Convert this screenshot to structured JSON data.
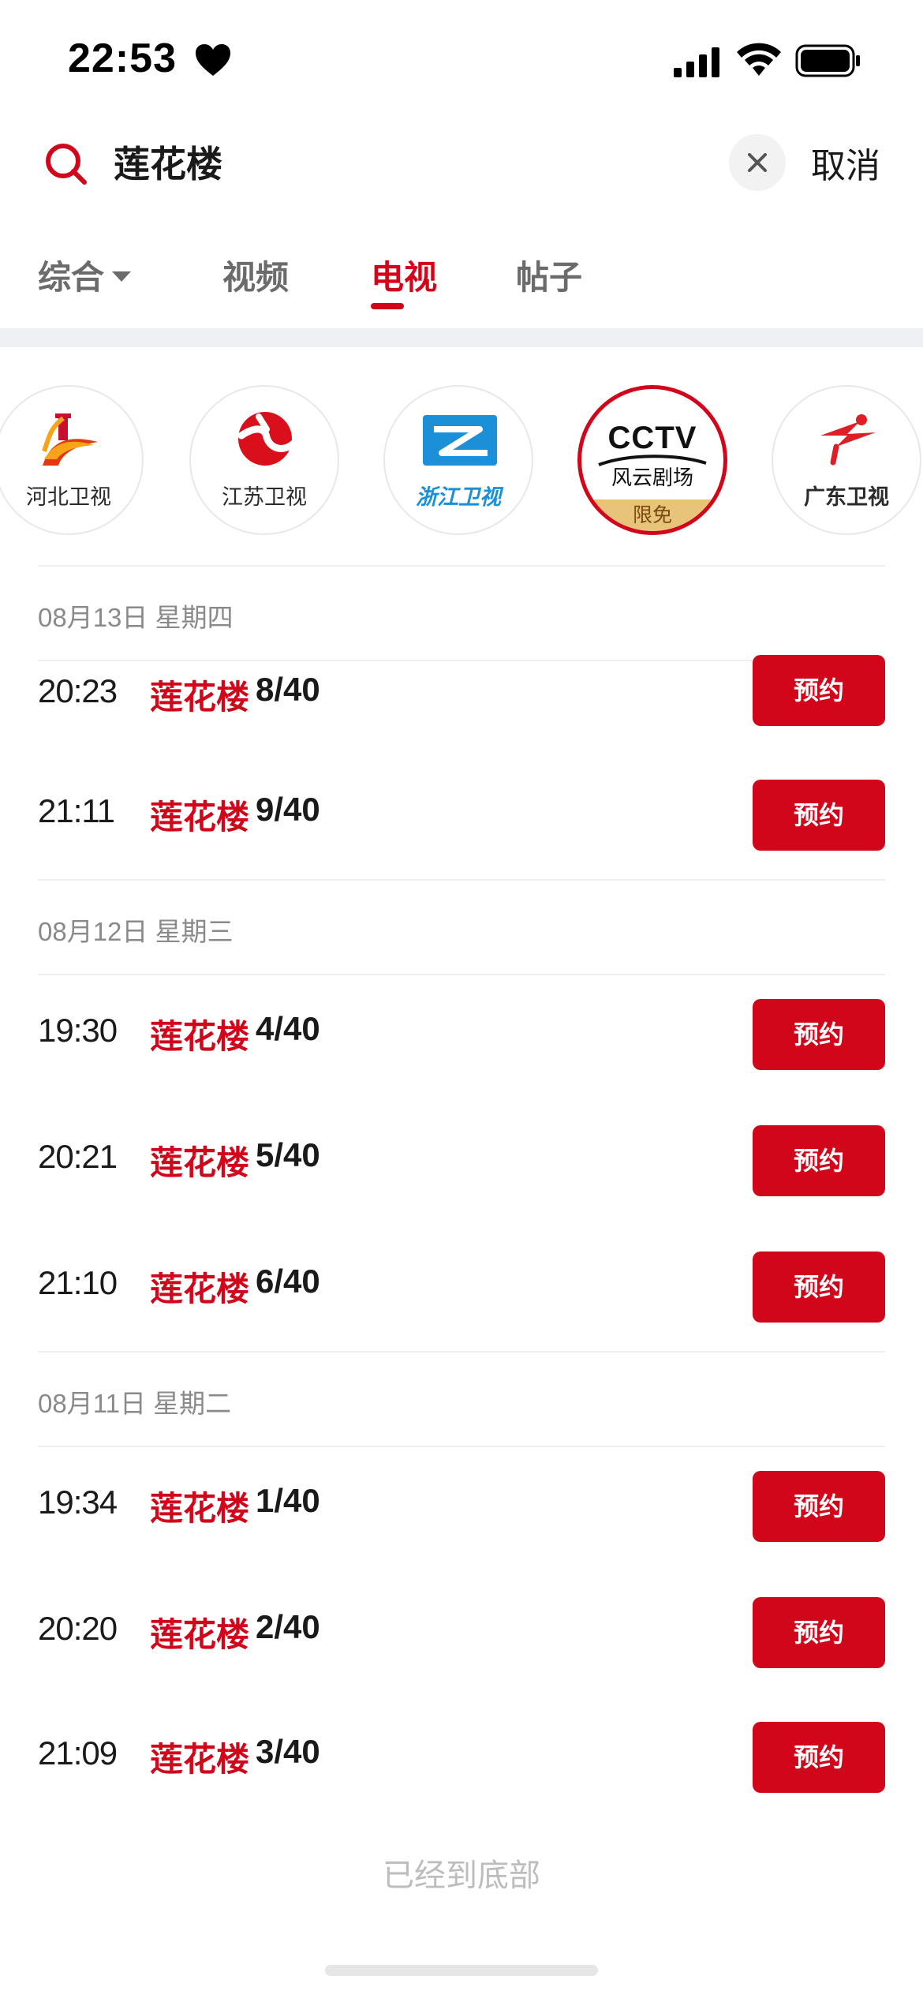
{
  "status_bar": {
    "time": "22:53"
  },
  "search": {
    "query": "莲花楼",
    "cancel_label": "取消"
  },
  "tabs": [
    {
      "label": "综合",
      "has_dropdown": true
    },
    {
      "label": "视频"
    },
    {
      "label": "电视",
      "active": true
    },
    {
      "label": "帖子"
    }
  ],
  "channels": [
    {
      "name": "河北卫视"
    },
    {
      "name": "江苏卫视"
    },
    {
      "name": "浙江卫视"
    },
    {
      "name": "CCTV",
      "subname": "风云剧场",
      "badge": "限免",
      "selected": true
    },
    {
      "name": "广东卫视"
    }
  ],
  "schedule": [
    {
      "date": "08月13日 星期四",
      "items": [
        {
          "time": "20:23",
          "title": "莲花楼",
          "episode": "8/40",
          "button": "预约"
        },
        {
          "time": "21:11",
          "title": "莲花楼",
          "episode": "9/40",
          "button": "预约"
        }
      ]
    },
    {
      "date": "08月12日 星期三",
      "items": [
        {
          "time": "19:30",
          "title": "莲花楼",
          "episode": "4/40",
          "button": "预约"
        },
        {
          "time": "20:21",
          "title": "莲花楼",
          "episode": "5/40",
          "button": "预约"
        },
        {
          "time": "21:10",
          "title": "莲花楼",
          "episode": "6/40",
          "button": "预约"
        }
      ]
    },
    {
      "date": "08月11日 星期二",
      "items": [
        {
          "time": "19:34",
          "title": "莲花楼",
          "episode": "1/40",
          "button": "预约"
        },
        {
          "time": "20:20",
          "title": "莲花楼",
          "episode": "2/40",
          "button": "预约"
        },
        {
          "time": "21:09",
          "title": "莲花楼",
          "episode": "3/40",
          "button": "预约"
        }
      ]
    }
  ],
  "end_text": "已经到底部",
  "colors": {
    "accent": "#d2061a",
    "muted": "#8a8a8a",
    "divider": "#eef0f3",
    "badge": "#e8c47b"
  }
}
